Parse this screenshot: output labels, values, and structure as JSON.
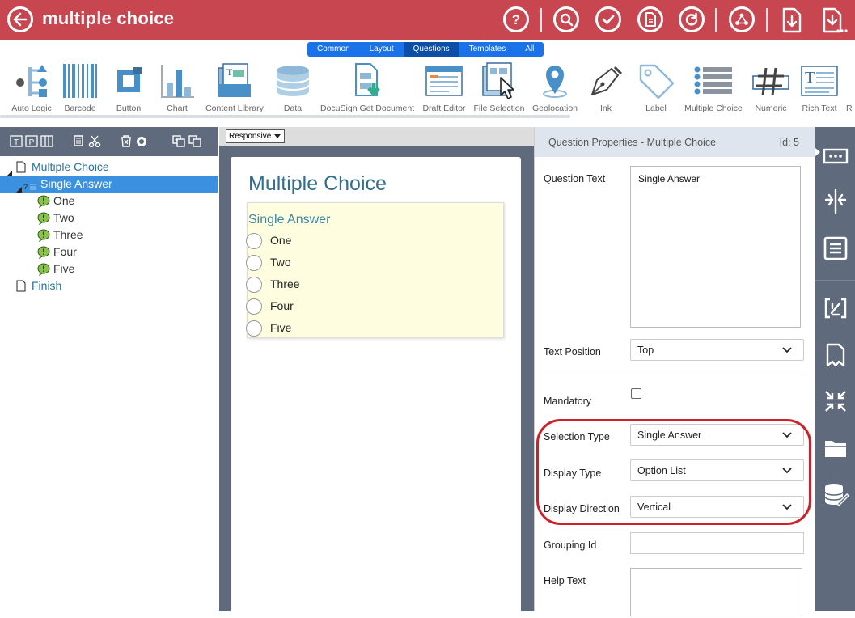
{
  "header": {
    "title": "multiple choice",
    "icons": [
      "back-icon",
      "help-icon",
      "search-icon",
      "check-icon",
      "document-icon",
      "refresh-icon",
      "share-icon",
      "file-download-icon",
      "file-export-icon"
    ]
  },
  "toolbar": {
    "tabs": [
      "Common",
      "Layout",
      "Questions",
      "Templates",
      "All"
    ],
    "active_tab": "Questions",
    "items": [
      "Auto Logic",
      "Barcode",
      "Button",
      "Chart",
      "Content Library",
      "Data",
      "DocuSign Get Document",
      "Draft Editor",
      "File Selection",
      "Geolocation",
      "Ink",
      "Label",
      "Multiple Choice",
      "Numeric",
      "Rich Text",
      "R"
    ]
  },
  "tree": {
    "root": "Multiple Choice",
    "question": "Single Answer",
    "question_prefix": "?",
    "options": [
      "One",
      "Two",
      "Three",
      "Four",
      "Five"
    ],
    "finish": "Finish"
  },
  "canvas": {
    "layout_select": "Responsive",
    "page_title": "Multiple Choice",
    "question_label": "Single Answer",
    "options": [
      "One",
      "Two",
      "Three",
      "Four",
      "Five"
    ]
  },
  "props": {
    "title": "Question Properties - Multiple Choice",
    "id_label": "Id: 5",
    "question_text_label": "Question Text",
    "question_text_value": "Single Answer",
    "text_position_label": "Text Position",
    "text_position_value": "Top",
    "mandatory_label": "Mandatory",
    "mandatory_checked": false,
    "selection_type_label": "Selection Type",
    "selection_type_value": "Single Answer",
    "display_type_label": "Display Type",
    "display_type_value": "Option List",
    "display_direction_label": "Display Direction",
    "display_direction_value": "Vertical",
    "grouping_id_label": "Grouping Id",
    "grouping_id_value": "",
    "help_text_label": "Help Text",
    "help_text_value": ""
  },
  "colors": {
    "header_bg": "#c8464f",
    "panel_gray": "#5f6b7c",
    "tab_blue": "#1a73e8",
    "selection_blue": "#3b91e0",
    "highlight_red": "#d11f2a"
  }
}
